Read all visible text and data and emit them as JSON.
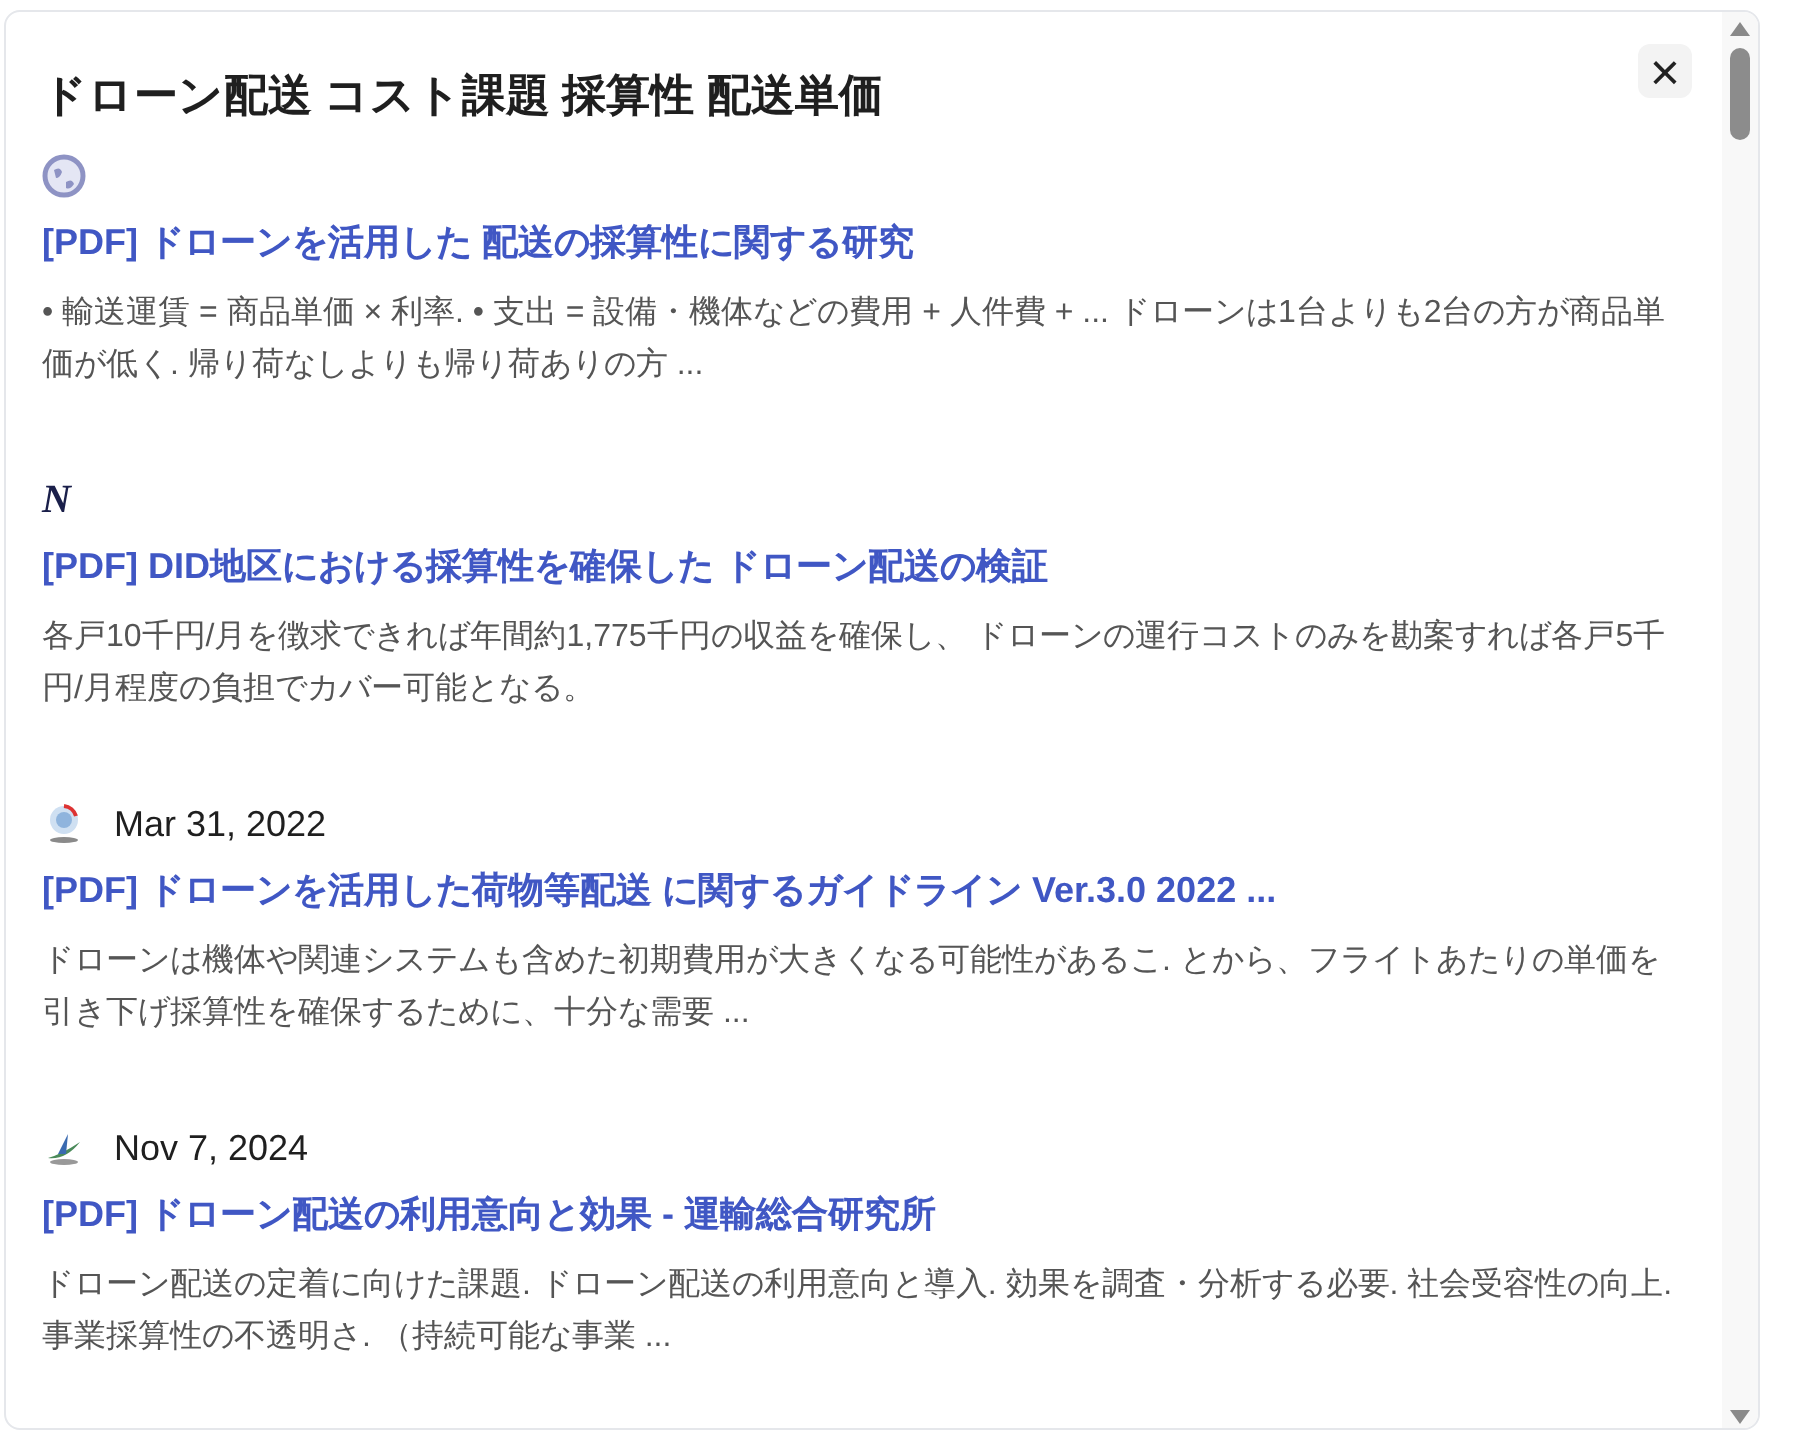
{
  "heading": "ドローン配送 コスト課題 採算性 配送単価",
  "close_button": {
    "label": "×"
  },
  "results": [
    {
      "icon": {
        "kind": "globe"
      },
      "title": "[PDF] ドローンを活用した 配送の採算性に関する研究",
      "snippet": "• 輸送運賃 = 商品単価 × 利率. • 支出 = 設備・機体などの費用 + 人件費 + ... ドローンは1台よりも2台の方が商品単価が低く. 帰り荷なしよりも帰り荷ありの方 ..."
    },
    {
      "icon": {
        "kind": "letter",
        "text": "N"
      },
      "title": "[PDF] DID地区における採算性を確保した ドローン配送の検証",
      "snippet": "各戸10千円/月を徴求できれば年間約1,775千円の収益を確保し、 ドローンの運行コストのみを勘案すれば各戸5千円/月程度の負担でカバー可能となる。"
    },
    {
      "icon": {
        "kind": "ring"
      },
      "date": "Mar 31, 2022",
      "title": "[PDF] ドローンを活用した荷物等配送 に関するガイドライン Ver.3.0 2022 ...",
      "snippet": "ドローンは機体や関連システムも含めた初期費用が大きくなる可能性があるこ. とから、フライトあたりの単価を引き下げ採算性を確保するために、十分な需要 ..."
    },
    {
      "icon": {
        "kind": "swoosh"
      },
      "date": "Nov 7, 2024",
      "title": "[PDF] ドローン配送の利用意向と効果 - 運輸総合研究所",
      "snippet": "ドローン配送の定着に向けた課題. ドローン配送の利用意向と導入. 効果を調査・分析する必要. 社会受容性の向上. 事業採算性の不透明さ. （持続可能な事業 ..."
    }
  ]
}
